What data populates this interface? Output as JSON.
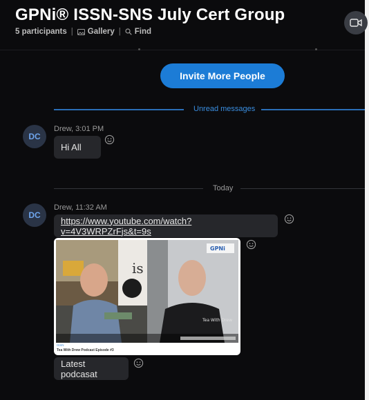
{
  "header": {
    "title": "GPNi® ISSN-SNS July Cert Group",
    "participants": "5 participants",
    "gallery": "Gallery",
    "find": "Find"
  },
  "invite_label": "Invite More People",
  "unread_label": "Unread messages",
  "today_label": "Today",
  "messages": [
    {
      "initials": "DC",
      "meta": "Drew, 3:01 PM",
      "text": "Hi All"
    },
    {
      "initials": "DC",
      "meta": "Drew, 11:32 AM",
      "link": "https://www.youtube.com/watch?v=4V3WRPZrFjs&t=9s",
      "preview": {
        "site": "ISSN",
        "caption_small": "Tea With Drew Podcast Episode #3",
        "video_text": "Tea With Drew",
        "logo": "GPNi"
      },
      "text": "Latest podcasat"
    }
  ],
  "colors": {
    "accent": "#1c7cd6",
    "background": "#0b0b0d",
    "bubble": "#26272b"
  }
}
